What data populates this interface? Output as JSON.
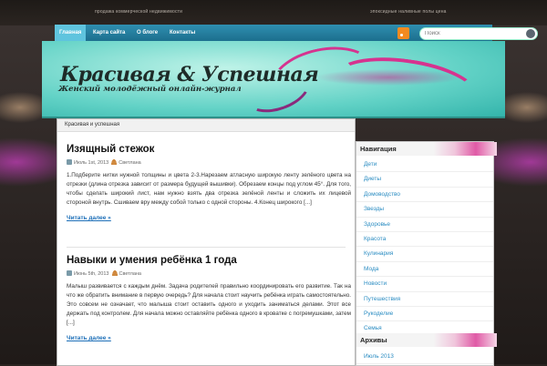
{
  "top_links": {
    "left": "продажа коммерческой недвижимости",
    "right": "эпоксидные наливные полы цена"
  },
  "nav": {
    "items": [
      "Главная",
      "Карта сайта",
      "О блоге",
      "Контакты"
    ],
    "active": "Главная"
  },
  "search": {
    "placeholder": "Поиск"
  },
  "site": {
    "title": "Красивая & Успешная",
    "tagline": "Женский молодёжный онлайн-журнал"
  },
  "breadcrumb": "Красивая и успешная",
  "posts": [
    {
      "title": "Изящный стежок",
      "date": "Июль 1st, 2013",
      "author": "Светлана",
      "excerpt": "1.Подберите нитки нужной толщины и цвета 2-3.Нарезаем атласную широкую ленту зелёного цвета на отрезки (длина отрезка зависит от размера будущей вышивки). Обрезаем концы под углом 45°. Для того, чтобы сделать широкий лист, нам нужно взять два отрезка зелёной ленты и сложить их лицевой стороной внутрь. Сшиваем вру между собой только с одной стороны. 4.Конец широкого [...]",
      "read_more": "Читать далее »"
    },
    {
      "title": "Навыки и умения ребёнка 1 года",
      "date": "Июнь 5th, 2013",
      "author": "Светлана",
      "excerpt": "Малыш развивается с каждым днём. Задача родителей правильно координировать его развитие. Так на что же обратить внимание в первую очередь? Для начала стоит научить ребёнка играть самостоятельно. Это совсем не означает, что малыша стоит оставить одного и уходить заниматься делами. Этот все держать под контролем. Для начала можно оставляйте ребёнка одного в кроватке с погремушками, затем [...]",
      "read_more": "Читать далее »"
    }
  ],
  "sidebar": {
    "nav_title": "Навигация",
    "nav_items": [
      "Дети",
      "Диеты",
      "Домоводство",
      "Звезды",
      "Здоровье",
      "Красота",
      "Кулинария",
      "Мода",
      "Новости",
      "Путешествия",
      "Рукоделие",
      "Семья"
    ],
    "archive_title": "Архивы",
    "archive_items": [
      "Июль 2013"
    ]
  },
  "colors": {
    "nav_bar": "#1b6d8c",
    "nav_active": "#5fc4de",
    "link": "#2a8cc2",
    "header_teal": "#62d2c6",
    "accent_pink": "#d6338f"
  }
}
